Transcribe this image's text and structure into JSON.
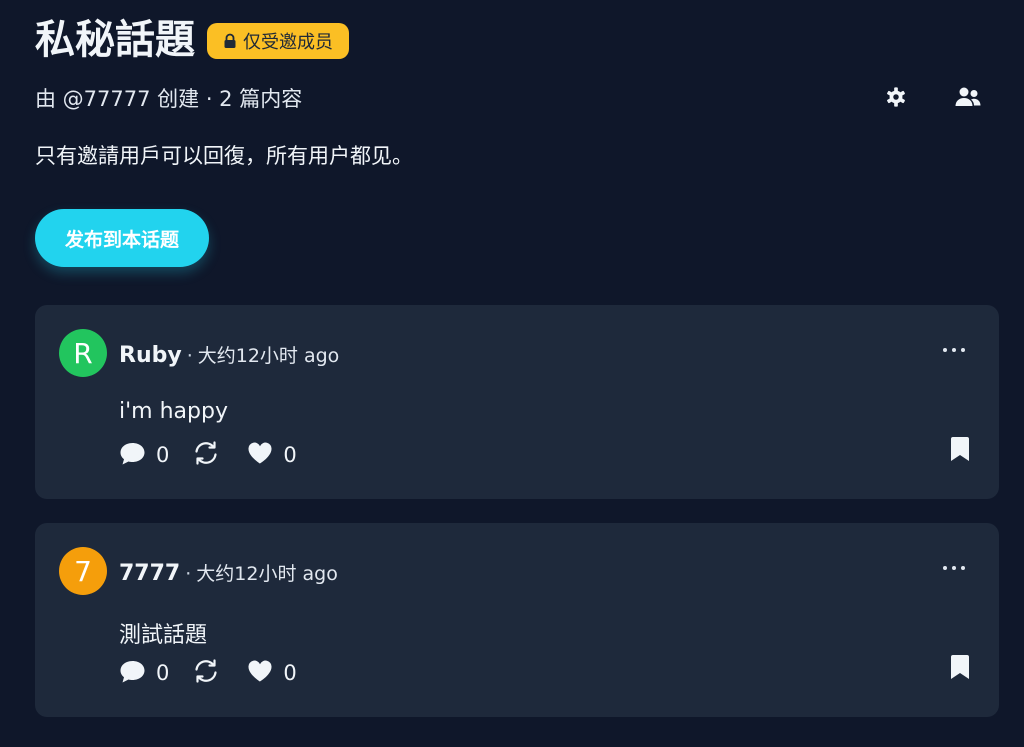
{
  "topic": {
    "title": "私秘話題",
    "badge": "仅受邀成员",
    "meta": "由 @77777 创建 · 2 篇内容",
    "description": "只有邀請用戶可以回復，所有用户都见。",
    "post_button": "发布到本话题"
  },
  "colors": {
    "background": "#0f172a",
    "card": "#1e293b",
    "accent": "#22d3ee",
    "badge": "#fbbf24"
  },
  "posts": [
    {
      "avatar_letter": "R",
      "avatar_color": "#22c55e",
      "author": "Ruby",
      "separator": "·",
      "time": "大约12小时 ago",
      "content": "i'm happy",
      "comments": "0",
      "likes": "0"
    },
    {
      "avatar_letter": "7",
      "avatar_color": "#f59e0b",
      "author": "7777",
      "separator": "·",
      "time": "大约12小时 ago",
      "content": "測試話題",
      "comments": "0",
      "likes": "0"
    }
  ],
  "icons": {
    "badge": "lock-icon",
    "settings": "gear-icon",
    "members": "users-icon",
    "comment": "comment-icon",
    "repost": "repost-icon",
    "like": "heart-icon",
    "bookmark": "bookmark-icon",
    "more": "more-icon"
  }
}
